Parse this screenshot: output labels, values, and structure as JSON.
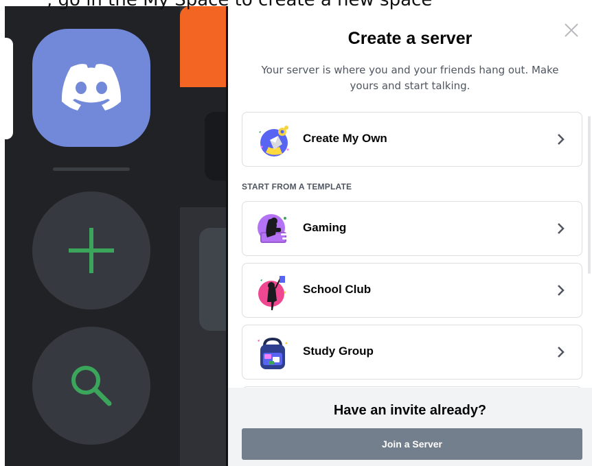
{
  "caption": {
    "text": ", go in the My Space to create a new space"
  },
  "modal": {
    "title": "Create a server",
    "subtitle": "Your server is where you and your friends hang out. Make yours and start talking.",
    "create_own": {
      "label": "Create My Own",
      "icon": "create-server-illustration"
    },
    "template_section_label": "START FROM A TEMPLATE",
    "templates": [
      {
        "label": "Gaming",
        "icon": "gaming-illustration"
      },
      {
        "label": "School Club",
        "icon": "school-club-illustration"
      },
      {
        "label": "Study Group",
        "icon": "study-group-illustration"
      }
    ],
    "footer": {
      "heading": "Have an invite already?",
      "join_label": "Join a Server"
    }
  },
  "colors": {
    "blurple": "#7289da",
    "rail_bg": "#202225",
    "green": "#3ba55c",
    "join_button": "#747f8d",
    "footer_bg": "#f2f3f5"
  }
}
